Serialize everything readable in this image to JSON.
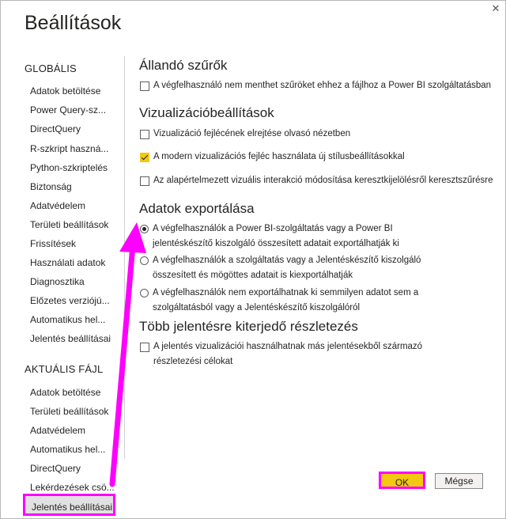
{
  "dialog": {
    "title": "Beállítások",
    "close_glyph": "✕"
  },
  "sidebar": {
    "global_header": "GLOBÁLIS",
    "global_items": [
      {
        "label": "Adatok betöltése"
      },
      {
        "label": "Power Query-sz..."
      },
      {
        "label": "DirectQuery"
      },
      {
        "label": "R-szkript haszná..."
      },
      {
        "label": "Python-szkriptelés"
      },
      {
        "label": "Biztonság"
      },
      {
        "label": "Adatvédelem"
      },
      {
        "label": "Területi beállítások"
      },
      {
        "label": "Frissítések"
      },
      {
        "label": "Használati adatok"
      },
      {
        "label": "Diagnosztika"
      },
      {
        "label": "Előzetes verziójú..."
      },
      {
        "label": "Automatikus hel..."
      },
      {
        "label": "Jelentés beállításai"
      }
    ],
    "file_header": "AKTUÁLIS FÁJL",
    "file_items": [
      {
        "label": "Adatok betöltése"
      },
      {
        "label": "Területi beállítások"
      },
      {
        "label": "Adatvédelem"
      },
      {
        "label": "Automatikus hel..."
      },
      {
        "label": "DirectQuery"
      },
      {
        "label": "Lekérdezések csö..."
      },
      {
        "label": "Jelentés beállításai"
      }
    ]
  },
  "sections": {
    "persistent_filters": {
      "title": "Állandó szűrők",
      "option": {
        "label": "A végfelhasználó nem menthet szűröket ehhez a fájlhoz a Power BI szolgáltatásban",
        "checked": false
      }
    },
    "visual_settings": {
      "title": "Vizualizációbeállítások",
      "options": [
        {
          "label": "Vizualizáció fejlécének elrejtése olvasó nézetben",
          "checked": false
        },
        {
          "label": "A modern vizualizációs fejléc használata új stílusbeállításokkal",
          "checked": true
        },
        {
          "label": "Az alapértelmezett vizuális interakció módosítása keresztkijelölésről keresztszűrésre",
          "checked": false
        }
      ]
    },
    "export_data": {
      "title": "Adatok exportálása",
      "options": [
        {
          "line1": "A végfelhasználók a Power BI-szolgáltatás vagy a Power BI",
          "line2": "jelentéskészítő kiszolgáló összesített adatait exportálhatják ki",
          "selected": true
        },
        {
          "line1": "A végfelhasználók a szolgáltatás vagy a Jelentéskészítő kiszolgáló",
          "line2": "összesített és mögöttes adatait is kiexportálhatják",
          "selected": false
        },
        {
          "line1": "A végfelhasználók nem exportálhatnak ki semmilyen adatot sem a",
          "line2": "szolgáltatásból vagy a Jelentéskészítő kiszolgálóról",
          "selected": false
        }
      ]
    },
    "cross_report": {
      "title": "Több jelentésre kiterjedő részletezés",
      "option": {
        "line1": "A jelentés vizualizációi használhatnak más jelentésekből származó",
        "line2": "részletezési célokat",
        "checked": false
      }
    }
  },
  "buttons": {
    "ok": "OK",
    "cancel": "Mégse"
  },
  "annotation": {
    "color": "#ff00ff"
  }
}
